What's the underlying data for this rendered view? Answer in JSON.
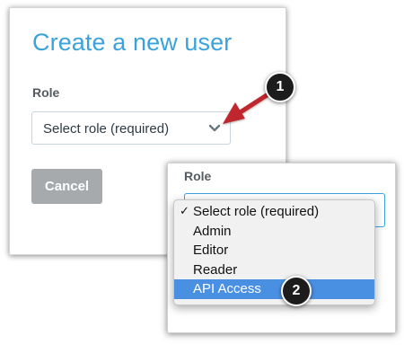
{
  "dialog": {
    "title": "Create a new user",
    "role_label": "Role",
    "role_select_value": "Select role (required)",
    "cancel_label": "Cancel"
  },
  "zoom": {
    "role_label": "Role",
    "dropdown": {
      "options": [
        {
          "label": "Select role (required)",
          "checked": true,
          "highlighted": false
        },
        {
          "label": "Admin",
          "checked": false,
          "highlighted": false
        },
        {
          "label": "Editor",
          "checked": false,
          "highlighted": false
        },
        {
          "label": "Reader",
          "checked": false,
          "highlighted": false
        },
        {
          "label": "API Access",
          "checked": false,
          "highlighted": true
        }
      ],
      "check_glyph": "✓"
    }
  },
  "annotations": {
    "badge_1": "1",
    "badge_2": "2",
    "arrow_color": "#c0282d"
  },
  "colors": {
    "accent": "#3aa2dc",
    "highlight": "#4a90e2",
    "button_gray": "#a6aaad"
  },
  "icons": {
    "select_chevron": "chevron-down-icon",
    "annotation_arrow": "arrow-icon"
  }
}
